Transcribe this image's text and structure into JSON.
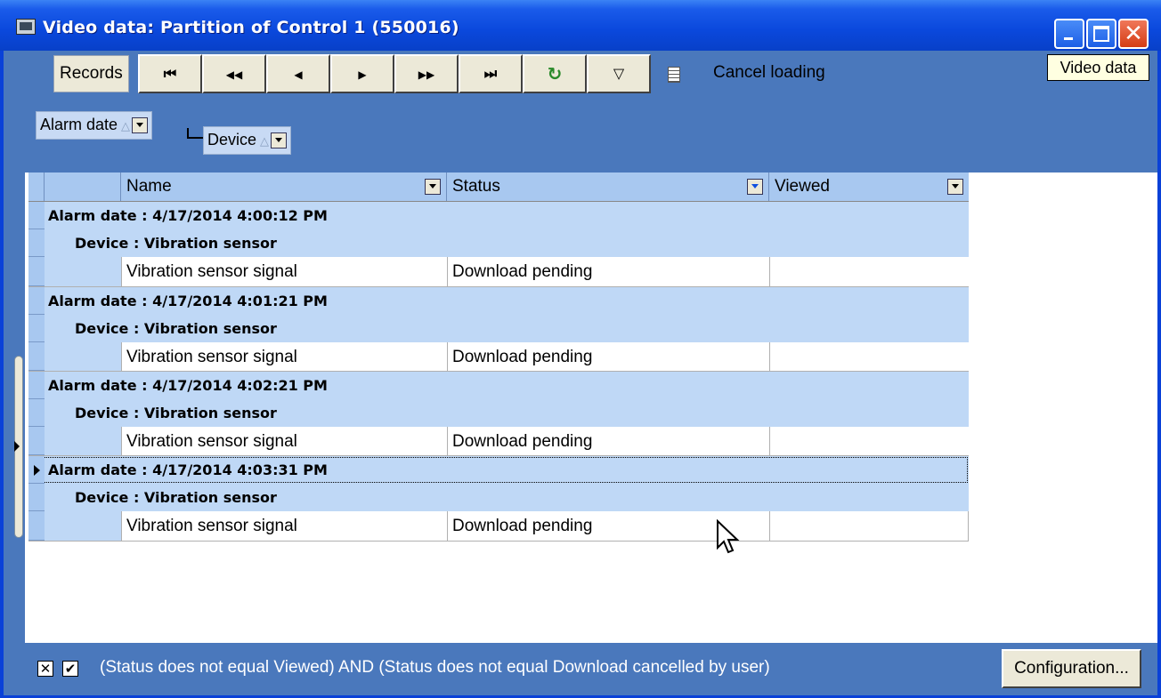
{
  "window": {
    "title": "Video data: Partition of Control 1 (550016)",
    "close_glyph": "✕"
  },
  "toolbar": {
    "records_label": "Records",
    "buttons": [
      {
        "name": "first-record-button",
        "glyph": "⏮"
      },
      {
        "name": "prev-page-button",
        "glyph": "◀◀"
      },
      {
        "name": "prev-record-button",
        "glyph": "◀"
      },
      {
        "name": "next-record-button",
        "glyph": "▶"
      },
      {
        "name": "next-page-button",
        "glyph": "▶▶"
      },
      {
        "name": "last-record-button",
        "glyph": "⏭"
      },
      {
        "name": "refresh-button",
        "glyph": "↻"
      },
      {
        "name": "filter-button",
        "glyph": "▽"
      }
    ],
    "cancel_loading": "Cancel loading",
    "tooltip": "Video data"
  },
  "group_by": {
    "level1": "Alarm date",
    "level2": "Device",
    "sort_glyph": "△"
  },
  "grid": {
    "columns": [
      "Name",
      "Status",
      "Viewed"
    ],
    "groups": [
      {
        "date": "Alarm date : 4/17/2014 4:00:12 PM",
        "device": "Device : Vibration sensor",
        "name": "Vibration sensor signal",
        "status": "Download pending",
        "viewed": ""
      },
      {
        "date": "Alarm date : 4/17/2014 4:01:21 PM",
        "device": "Device : Vibration sensor",
        "name": "Vibration sensor signal",
        "status": "Download pending",
        "viewed": ""
      },
      {
        "date": "Alarm date : 4/17/2014 4:02:21 PM",
        "device": "Device : Vibration sensor",
        "name": "Vibration sensor signal",
        "status": "Download pending",
        "viewed": ""
      },
      {
        "date": "Alarm date : 4/17/2014 4:03:31 PM",
        "device": "Device : Vibration sensor",
        "name": "Vibration sensor signal",
        "status": "Download pending",
        "viewed": ""
      }
    ]
  },
  "footer": {
    "clear_glyph": "✕",
    "check_glyph": "✔",
    "filter_text": "(Status does not equal Viewed) AND (Status does not equal Download cancelled by user)",
    "config_button": "Configuration..."
  },
  "colors": {
    "title_bar": "#0a48dc",
    "panel": "#4a78bc",
    "group_row": "#bfd8f6",
    "header": "#a8c8f0"
  }
}
